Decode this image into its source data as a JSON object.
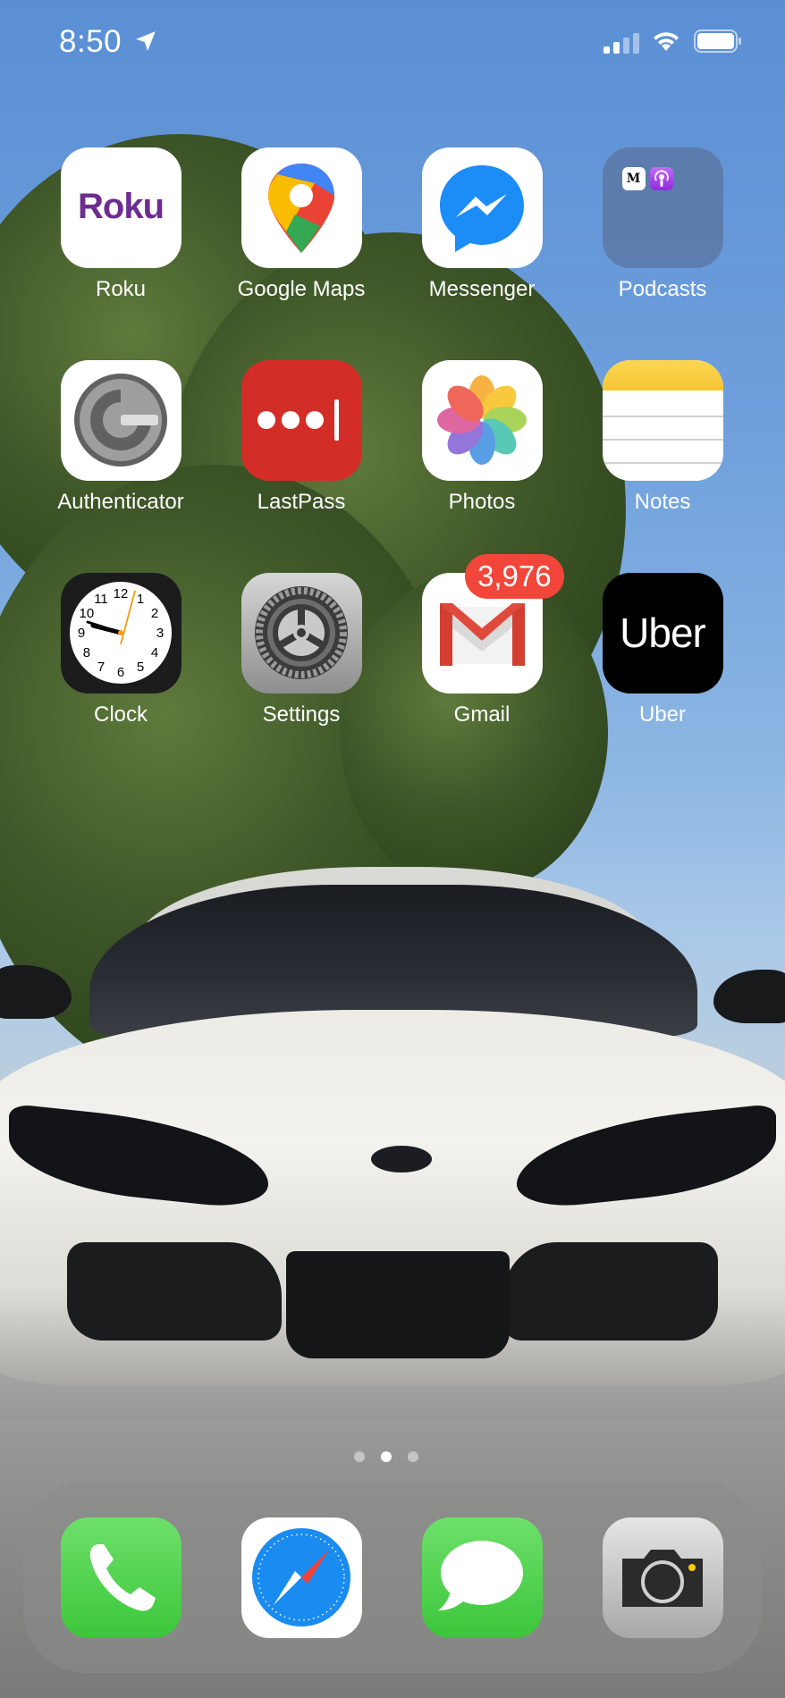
{
  "status_bar": {
    "time": "8:50"
  },
  "apps": [
    {
      "label": "Roku",
      "icon": "roku-icon"
    },
    {
      "label": "Google Maps",
      "icon": "google-maps-icon"
    },
    {
      "label": "Messenger",
      "icon": "messenger-icon"
    },
    {
      "label": "Podcasts",
      "icon": "folder-icon"
    },
    {
      "label": "Authenticator",
      "icon": "authenticator-icon"
    },
    {
      "label": "LastPass",
      "icon": "lastpass-icon"
    },
    {
      "label": "Photos",
      "icon": "photos-icon"
    },
    {
      "label": "Notes",
      "icon": "notes-icon"
    },
    {
      "label": "Clock",
      "icon": "clock-icon"
    },
    {
      "label": "Settings",
      "icon": "settings-icon"
    },
    {
      "label": "Gmail",
      "icon": "gmail-icon"
    },
    {
      "label": "Uber",
      "icon": "uber-icon"
    }
  ],
  "roku_logo": "Roku",
  "uber_logo": "Uber",
  "gmail_badge": "3,976",
  "clock_numbers": [
    "12",
    "1",
    "2",
    "3",
    "4",
    "5",
    "6",
    "7",
    "8",
    "9",
    "10",
    "11"
  ],
  "page_indicator": {
    "count": 3,
    "active": 2
  },
  "dock": [
    {
      "name": "Phone",
      "icon": "phone-icon"
    },
    {
      "name": "Safari",
      "icon": "safari-icon"
    },
    {
      "name": "Messages",
      "icon": "messages-icon"
    },
    {
      "name": "Camera",
      "icon": "camera-icon"
    }
  ],
  "colors": {
    "badge_red": "#f2463b",
    "roku_purple": "#6c2c91",
    "lastpass_red": "#d32d27",
    "phone_green": "#4cd964"
  }
}
